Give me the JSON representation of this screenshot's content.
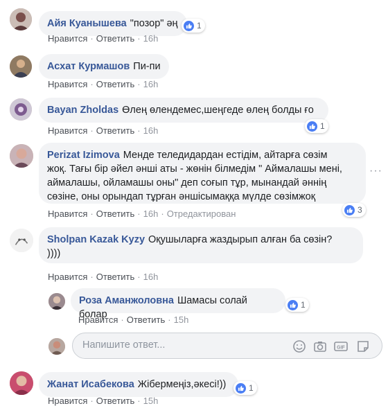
{
  "comments": [
    {
      "author": "Айя Куанышева",
      "text": "\"позор\" әң",
      "like": "Нравится",
      "reply": "Ответить",
      "time": "16h",
      "reactions": "1"
    },
    {
      "author": "Асхат Курмашов",
      "text": "Пи-пи",
      "like": "Нравится",
      "reply": "Ответить",
      "time": "16h"
    },
    {
      "author": "Bayan Zholdas",
      "text": "Өлең өлендемес,шеңгеде өлең болды ғо",
      "like": "Нравится",
      "reply": "Ответить",
      "time": "16h",
      "reactions": "1"
    },
    {
      "author": "Perizat Izimova",
      "text_lines": [
        "Менде теледидардан естідім, айтарға сөзім",
        "жоқ. Тағы бір әйел әнші аты - жөнін білмедім \" Аймалашы мені,",
        "аймалашы, ойламашы оны\" деп соғып тұр, мынандай әннің",
        "сөзіне, оны орындап тұрған әншісымаққа мүлде сөзімжоқ"
      ],
      "like": "Нравится",
      "reply": "Ответить",
      "time": "16h",
      "edited": "Отредактирован",
      "reactions": "3"
    },
    {
      "author": "Sholpan Kazak Kyzy",
      "text_lines": [
        "Оқушыларға жаздырып алған ба сөзін?",
        "))))"
      ],
      "like": "Нравится",
      "reply": "Ответить",
      "time": "16h"
    },
    {
      "author": "Роза Аманжоловна",
      "text": "Шамасы солай болар",
      "like": "Нравится",
      "reply": "Ответить",
      "time": "15h",
      "reactions": "1"
    },
    {
      "author": "Жанат Исабекова",
      "text": "Жібермеңіз,әкесі!))",
      "like": "Нравится",
      "reply": "Ответить",
      "time": "15h",
      "reactions": "1"
    }
  ],
  "reply_placeholder": "Напишите ответ...",
  "tools": [
    "emoji-icon",
    "camera-icon",
    "gif-icon",
    "sticker-icon"
  ],
  "colors": {
    "link": "#385898",
    "bubble": "#f2f3f5",
    "like": "#4a7ef4"
  }
}
